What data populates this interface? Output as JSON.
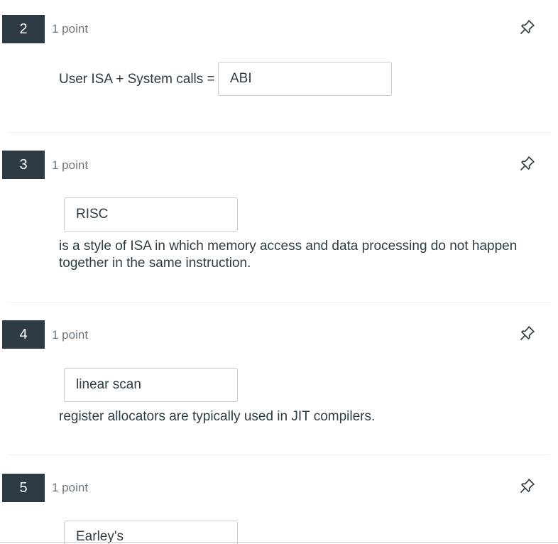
{
  "questions": [
    {
      "number": "2",
      "points": "1 point",
      "before_text": "User ISA + System calls =",
      "answer": "ABI",
      "after_text": ""
    },
    {
      "number": "3",
      "points": "1 point",
      "before_text": "",
      "answer": "RISC",
      "after_text": "is a style of ISA in which memory access and data processing do not happen together in the same instruction."
    },
    {
      "number": "4",
      "points": "1 point",
      "before_text": "",
      "answer": "linear scan",
      "after_text": "register allocators are typically used in JIT compilers."
    },
    {
      "number": "5",
      "points": "1 point",
      "before_text": "",
      "answer": "Earley's",
      "after_text": ""
    }
  ],
  "icons": {
    "pin": "pin-icon"
  },
  "colors": {
    "badge": "#2d3b45",
    "text": "#2d3b45",
    "muted": "#6b7780",
    "border": "#c7cdd1"
  }
}
